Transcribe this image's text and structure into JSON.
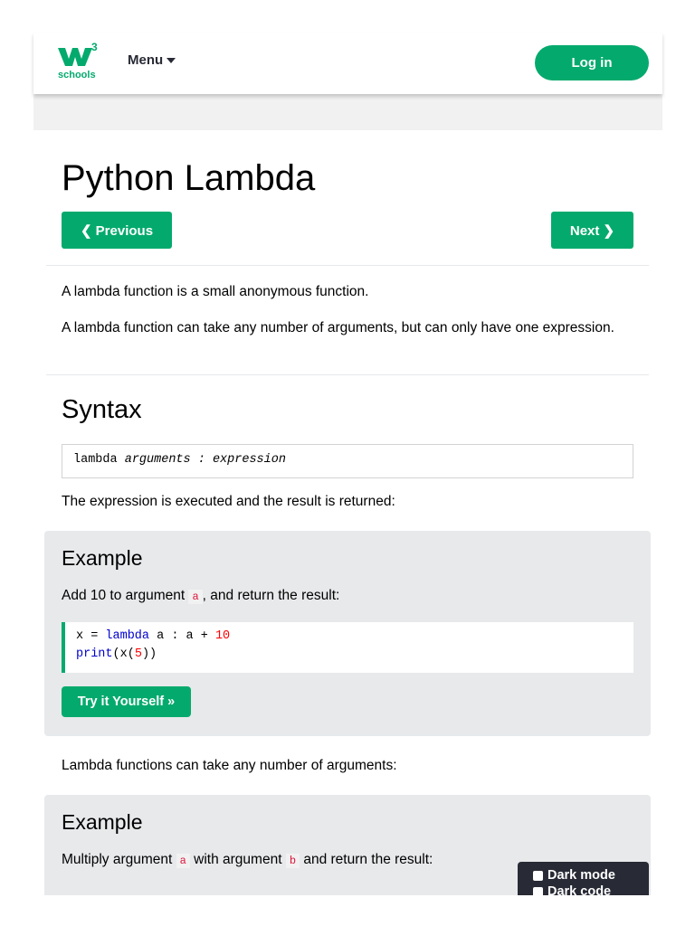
{
  "header": {
    "logo_sup": "3",
    "logo_word": "schools",
    "menu_label": "Menu",
    "login_label": "Log in"
  },
  "page": {
    "title": "Python Lambda",
    "prev_label": "❮ Previous",
    "next_label": "Next ❯",
    "intro1": "A lambda function is a small anonymous function.",
    "intro2": "A lambda function can take any number of arguments, but can only have one expression.",
    "syntax_heading": "Syntax",
    "syntax_kw": "lambda ",
    "syntax_args": "arguments",
    "syntax_sep": " : ",
    "syntax_expr": "expression",
    "syntax_note": "The expression is executed and the result is returned:",
    "between_text": "Lambda functions can take any number of arguments:"
  },
  "example1": {
    "title": "Example",
    "desc_pre": "Add 10 to argument ",
    "desc_code": "a",
    "desc_post": ", and return the result:",
    "line1_a": "x = ",
    "line1_kw": "lambda",
    "line1_b": " a : a + ",
    "line1_num": "10",
    "line2_fn": "print",
    "line2_a": "(x(",
    "line2_num": "5",
    "line2_b": "))",
    "try_label": "Try it Yourself »"
  },
  "example2": {
    "title": "Example",
    "desc_pre": "Multiply argument ",
    "desc_code1": "a",
    "desc_mid": " with argument ",
    "desc_code2": "b",
    "desc_post": " and return the result:"
  },
  "darkmode": {
    "label1": "Dark mode",
    "label2": "Dark code"
  },
  "colors": {
    "accent": "#04AA6D",
    "dark": "#282A35"
  }
}
